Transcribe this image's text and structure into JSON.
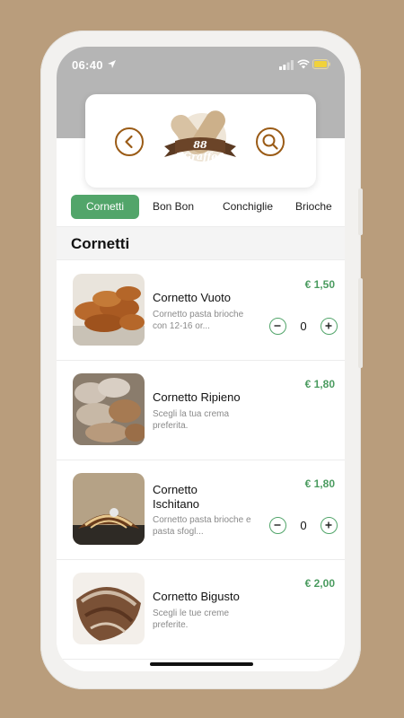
{
  "status_bar": {
    "time": "06:40"
  },
  "header": {
    "logo_text": "88 Graffe"
  },
  "tabs": [
    {
      "label": "Cornetti",
      "active": true
    },
    {
      "label": "Bon Bon",
      "active": false
    },
    {
      "label": "Conchiglie",
      "active": false
    },
    {
      "label": "Brioche",
      "active": false
    }
  ],
  "section": {
    "title": "Cornetti"
  },
  "products": [
    {
      "name": "Cornetto Vuoto",
      "description": "Cornetto pasta brioche con 12-16 or...",
      "price": "€ 1,50",
      "quantity": "0",
      "has_stepper": true
    },
    {
      "name": "Cornetto Ripieno",
      "description": "Scegli la tua crema preferita.",
      "price": "€ 1,80",
      "has_stepper": false
    },
    {
      "name": "Cornetto Ischitano",
      "description": "Cornetto pasta brioche e pasta sfogl...",
      "price": "€ 1,80",
      "quantity": "0",
      "has_stepper": true
    },
    {
      "name": "Cornetto Bigusto",
      "description": "Scegli le tue creme preferite.",
      "price": "€ 2,00",
      "has_stepper": false
    }
  ],
  "colors": {
    "accent_green": "#52a56a",
    "price_green": "#4a9b5f",
    "brand_brown": "#9a5b16",
    "background": "#b99d7c"
  }
}
